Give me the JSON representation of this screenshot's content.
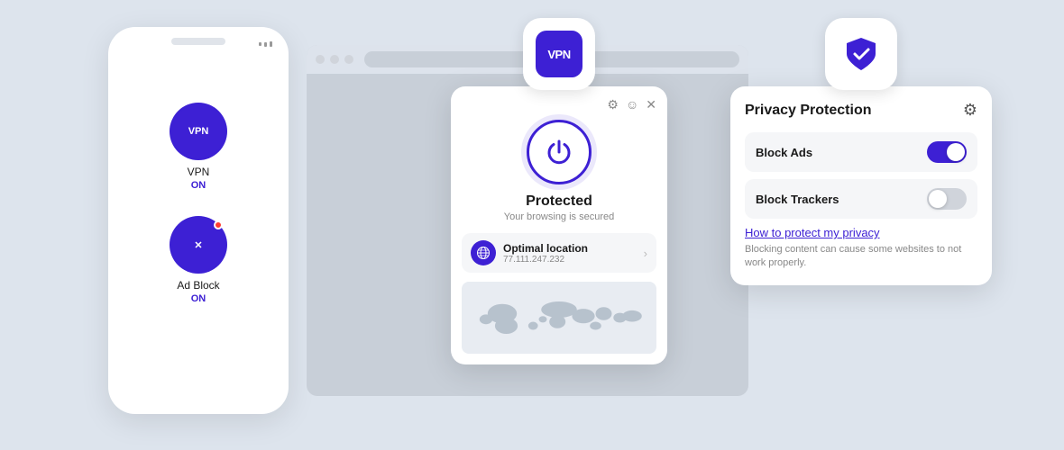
{
  "background": "#dde4ed",
  "phone": {
    "vpn_app": {
      "label": "VPN",
      "status": "ON",
      "icon_text": "VPN"
    },
    "adblock_app": {
      "label": "Ad Block",
      "status": "ON",
      "icon_text": "✕"
    }
  },
  "vpn_popup": {
    "app_badge_text": "VPN",
    "toolbar_icons": [
      "⚙",
      "☺",
      "✕"
    ],
    "status_title": "Protected",
    "status_subtitle": "Your browsing is secured",
    "location_name": "Optimal location",
    "location_ip": "77.111.247.232"
  },
  "privacy_popup": {
    "title": "Privacy Protection",
    "block_ads_label": "Block Ads",
    "block_ads_on": true,
    "block_trackers_label": "Block Trackers",
    "block_trackers_on": false,
    "help_link": "How to protect my privacy",
    "note": "Blocking content can cause some websites to not work properly."
  }
}
